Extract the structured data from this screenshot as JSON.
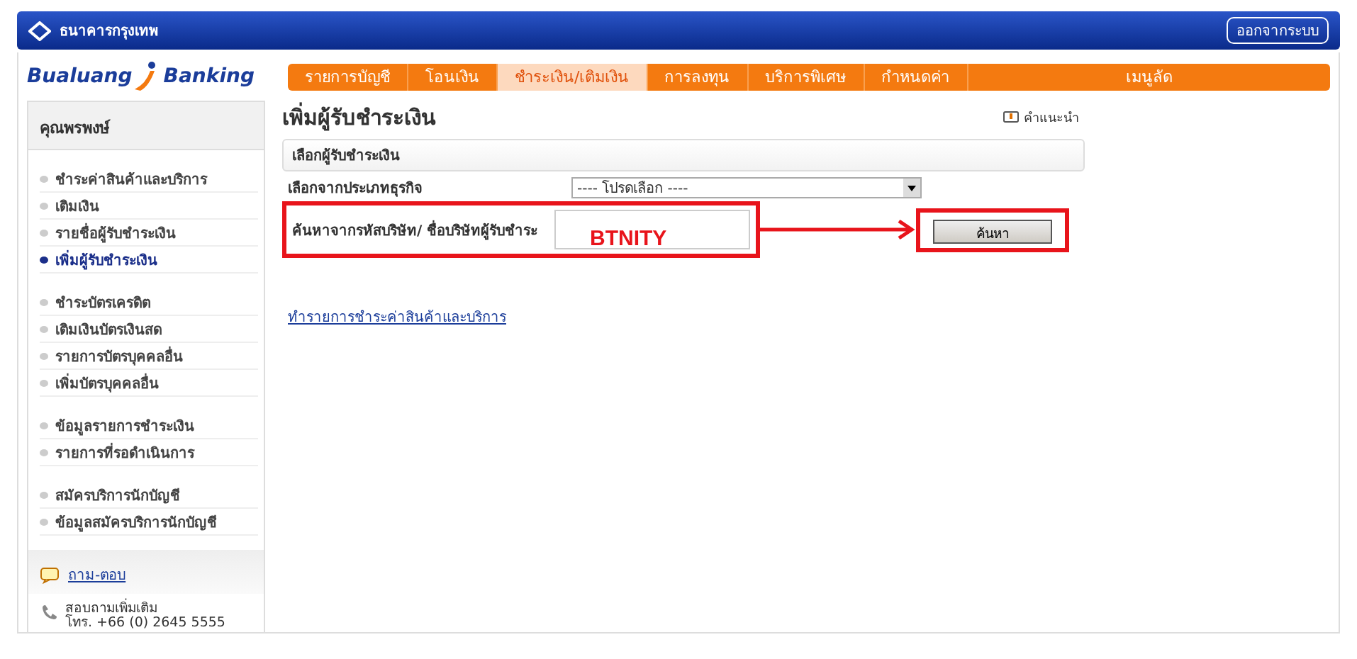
{
  "header": {
    "bank_name": "ธนาคารกรุงเทพ",
    "logout": "ออกจากระบบ"
  },
  "logo": {
    "left": "Bualuang",
    "right": "Banking"
  },
  "tabs": [
    {
      "label": "รายการบัญชี",
      "selected": false
    },
    {
      "label": "โอนเงิน",
      "selected": false
    },
    {
      "label": "ชำระเงิน/เติมเงิน",
      "selected": true
    },
    {
      "label": "การลงทุน",
      "selected": false
    },
    {
      "label": "บริการพิเศษ",
      "selected": false
    },
    {
      "label": "กำหนดค่า",
      "selected": false
    },
    {
      "label": "เมนูลัด",
      "selected": false
    }
  ],
  "sidebar": {
    "user": "คุณพรพงษ์",
    "groups": [
      [
        {
          "label": "ชำระค่าสินค้าและบริการ",
          "selected": false
        },
        {
          "label": "เติมเงิน",
          "selected": false
        },
        {
          "label": "รายชื่อผู้รับชำระเงิน",
          "selected": false
        },
        {
          "label": "เพิ่มผู้รับชำระเงิน",
          "selected": true
        }
      ],
      [
        {
          "label": "ชำระบัตรเครดิต",
          "selected": false
        },
        {
          "label": "เติมเงินบัตรเงินสด",
          "selected": false
        },
        {
          "label": "รายการบัตรบุคคลอื่น",
          "selected": false
        },
        {
          "label": "เพิ่มบัตรบุคคลอื่น",
          "selected": false
        }
      ],
      [
        {
          "label": "ข้อมูลรายการชำระเงิน",
          "selected": false
        },
        {
          "label": "รายการที่รอดำเนินการ",
          "selected": false
        }
      ],
      [
        {
          "label": "สมัครบริการนักบัญชี",
          "selected": false
        },
        {
          "label": "ข้อมูลสมัครบริการนักบัญชี",
          "selected": false
        }
      ]
    ],
    "faq": "ถาม-ตอบ",
    "contact_title": "สอบถามเพิ่มเติม",
    "contact_phone": "โทร. +66 (0) 2645 5555"
  },
  "main": {
    "title": "เพิ่มผู้รับชำระเงิน",
    "help": "คำแนะนำ",
    "section": "เลือกผู้รับชำระเงิน",
    "category_label": "เลือกจากประเภทธุรกิจ",
    "category_select": "---- โปรดเลือก ----",
    "search_label": "ค้นหาจากรหัสบริษัท/ ชื่อบริษัทผู้รับชำระ",
    "annotation": "BTNITY",
    "search_button": "ค้นหา",
    "link": "ทำรายการชำระค่าสินค้าและบริการ"
  }
}
